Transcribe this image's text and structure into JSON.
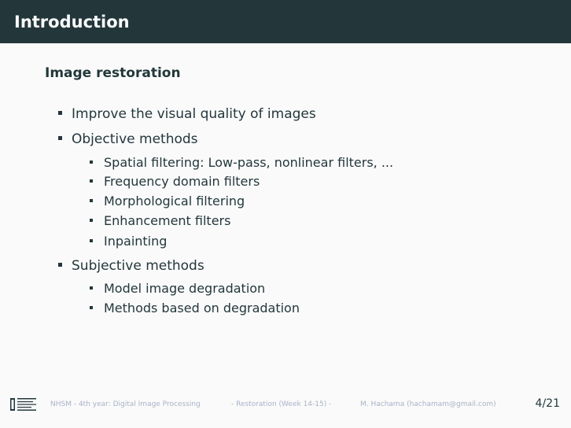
{
  "header": {
    "title": "Introduction"
  },
  "block": {
    "title": "Image restoration",
    "items": [
      {
        "label": "Improve the visual quality of images"
      },
      {
        "label": "Objective methods",
        "subitems": [
          "Spatial filtering: Low-pass, nonlinear filters, ...",
          "Frequency domain filters",
          "Morphological filtering",
          "Enhancement filters",
          "Inpainting"
        ]
      },
      {
        "label": "Subjective methods",
        "subitems": [
          "Model image degradation",
          "Methods based on degradation"
        ]
      }
    ]
  },
  "footer": {
    "course": "NHSM - 4th year: Digital Image Processing",
    "topic": "- Restoration (Week 14-15) -",
    "author": "M. Hachama (hachamam@gmail.com)",
    "page": "4/21",
    "logo_icon": "institution-logo-icon"
  }
}
